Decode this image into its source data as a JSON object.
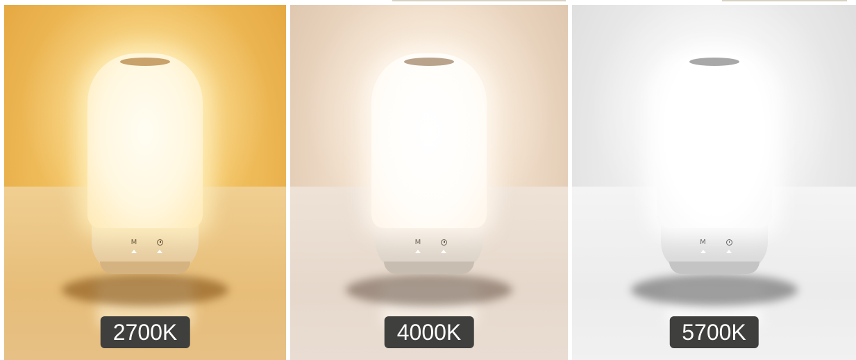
{
  "panels": [
    {
      "label": "2700K",
      "bg_color": "#e8ab3c",
      "glow_color": "#fff2cf",
      "table_color": "#e9c58a"
    },
    {
      "label": "4000K",
      "bg_color": "#e8d3bf",
      "glow_color": "#fffaf1",
      "table_color": "#eadcd0"
    },
    {
      "label": "5700K",
      "bg_color": "#eaeaea",
      "glow_color": "#ffffff",
      "table_color": "#f3f3f3"
    }
  ],
  "lamp": {
    "button_mode_glyph": "M",
    "mode_icon": "mode-button-icon",
    "timer_icon": "clock-icon"
  }
}
